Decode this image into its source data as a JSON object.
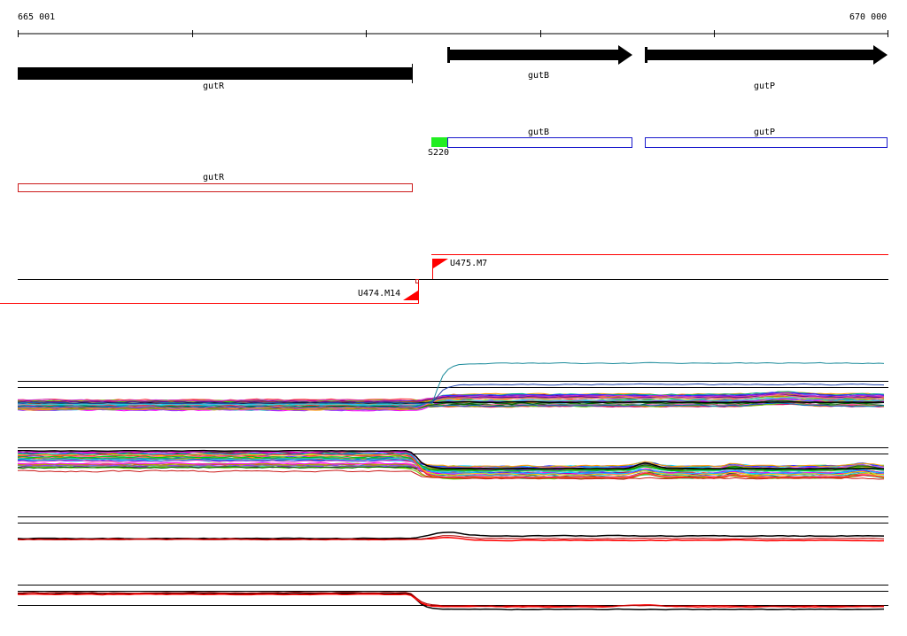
{
  "ruler": {
    "start_label": "665 001",
    "end_label": "670 000"
  },
  "genes": [
    {
      "name": "gutR",
      "strand": "-",
      "track": "annotation"
    },
    {
      "name": "gutB",
      "strand": "+",
      "track": "annotation"
    },
    {
      "name": "gutP",
      "strand": "+",
      "track": "annotation"
    }
  ],
  "transcripts_plus": [
    {
      "name": "gutB",
      "color": "#1a1acc"
    },
    {
      "name": "gutP",
      "color": "#1a1acc"
    }
  ],
  "transcripts_minus": [
    {
      "name": "gutR",
      "color": "#cc1a1a"
    }
  ],
  "sigma_site": {
    "label": "S220",
    "color": "#22ee22"
  },
  "upshifts": [
    {
      "label": "U475.M7",
      "strand": "+",
      "color": "#ff0000"
    },
    {
      "label": "U474.M14",
      "strand": "-",
      "color": "#ff0000"
    }
  ],
  "expression_panels": [
    {
      "name": "condition-profiles-plus",
      "style": "multicolor"
    },
    {
      "name": "condition-profiles-minus",
      "style": "multicolor"
    },
    {
      "name": "mean-profile-plus",
      "style": "black-red"
    },
    {
      "name": "mean-profile-minus",
      "style": "black-red"
    }
  ],
  "colors": {
    "gene_arrow": "#000000",
    "plus_transcript": "#1a1acc",
    "minus_transcript": "#cc1a1a",
    "sigma": "#22ee22",
    "upshift": "#ff0000"
  }
}
